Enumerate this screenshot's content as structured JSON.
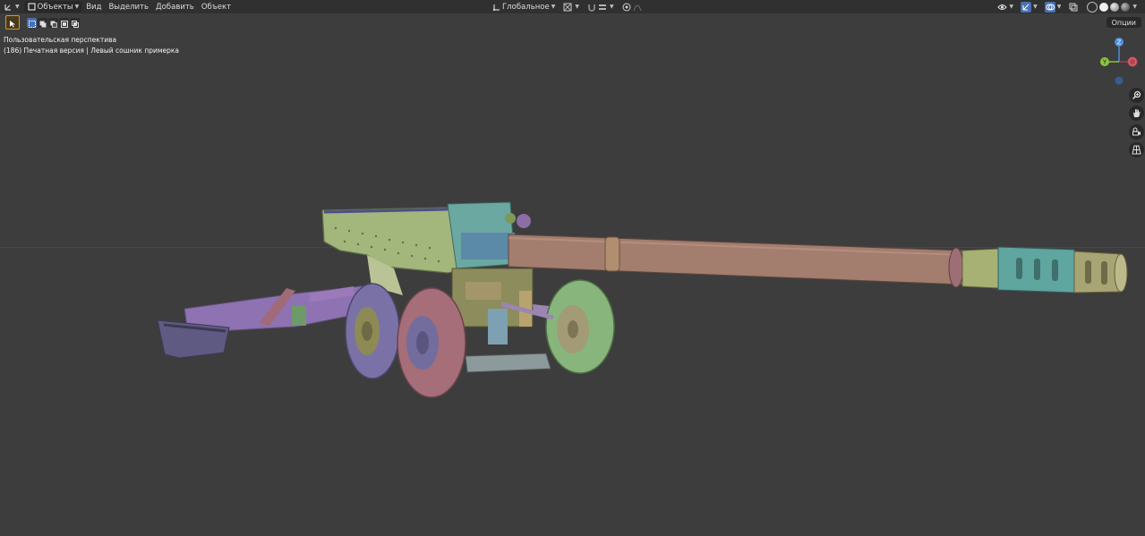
{
  "header": {
    "editor_type_icon": "axes-editor-icon",
    "mode_label": "Объекты",
    "menus": [
      "Вид",
      "Выделить",
      "Добавить",
      "Объект"
    ],
    "orientation_label": "Глобальное"
  },
  "overlay": {
    "view_name": "Пользовательская перспектива",
    "object_info": "(186) Печатная версия | Левый сошник примерка"
  },
  "options_label": "Опции",
  "gizmo": {
    "z_label": "Z",
    "y_label": "Y"
  },
  "colors": {
    "barrel": "#a37d6e",
    "muzzle_cyan": "#5fa5a0",
    "muzzle_olive": "#a8a574",
    "shield": "#a3b67b",
    "trail": "#8e72b2",
    "wheel_front": "#a56e78",
    "wheel_back": "#7a72a6",
    "wheel_right": "#87b57b",
    "accent_select": "#4772b3"
  }
}
